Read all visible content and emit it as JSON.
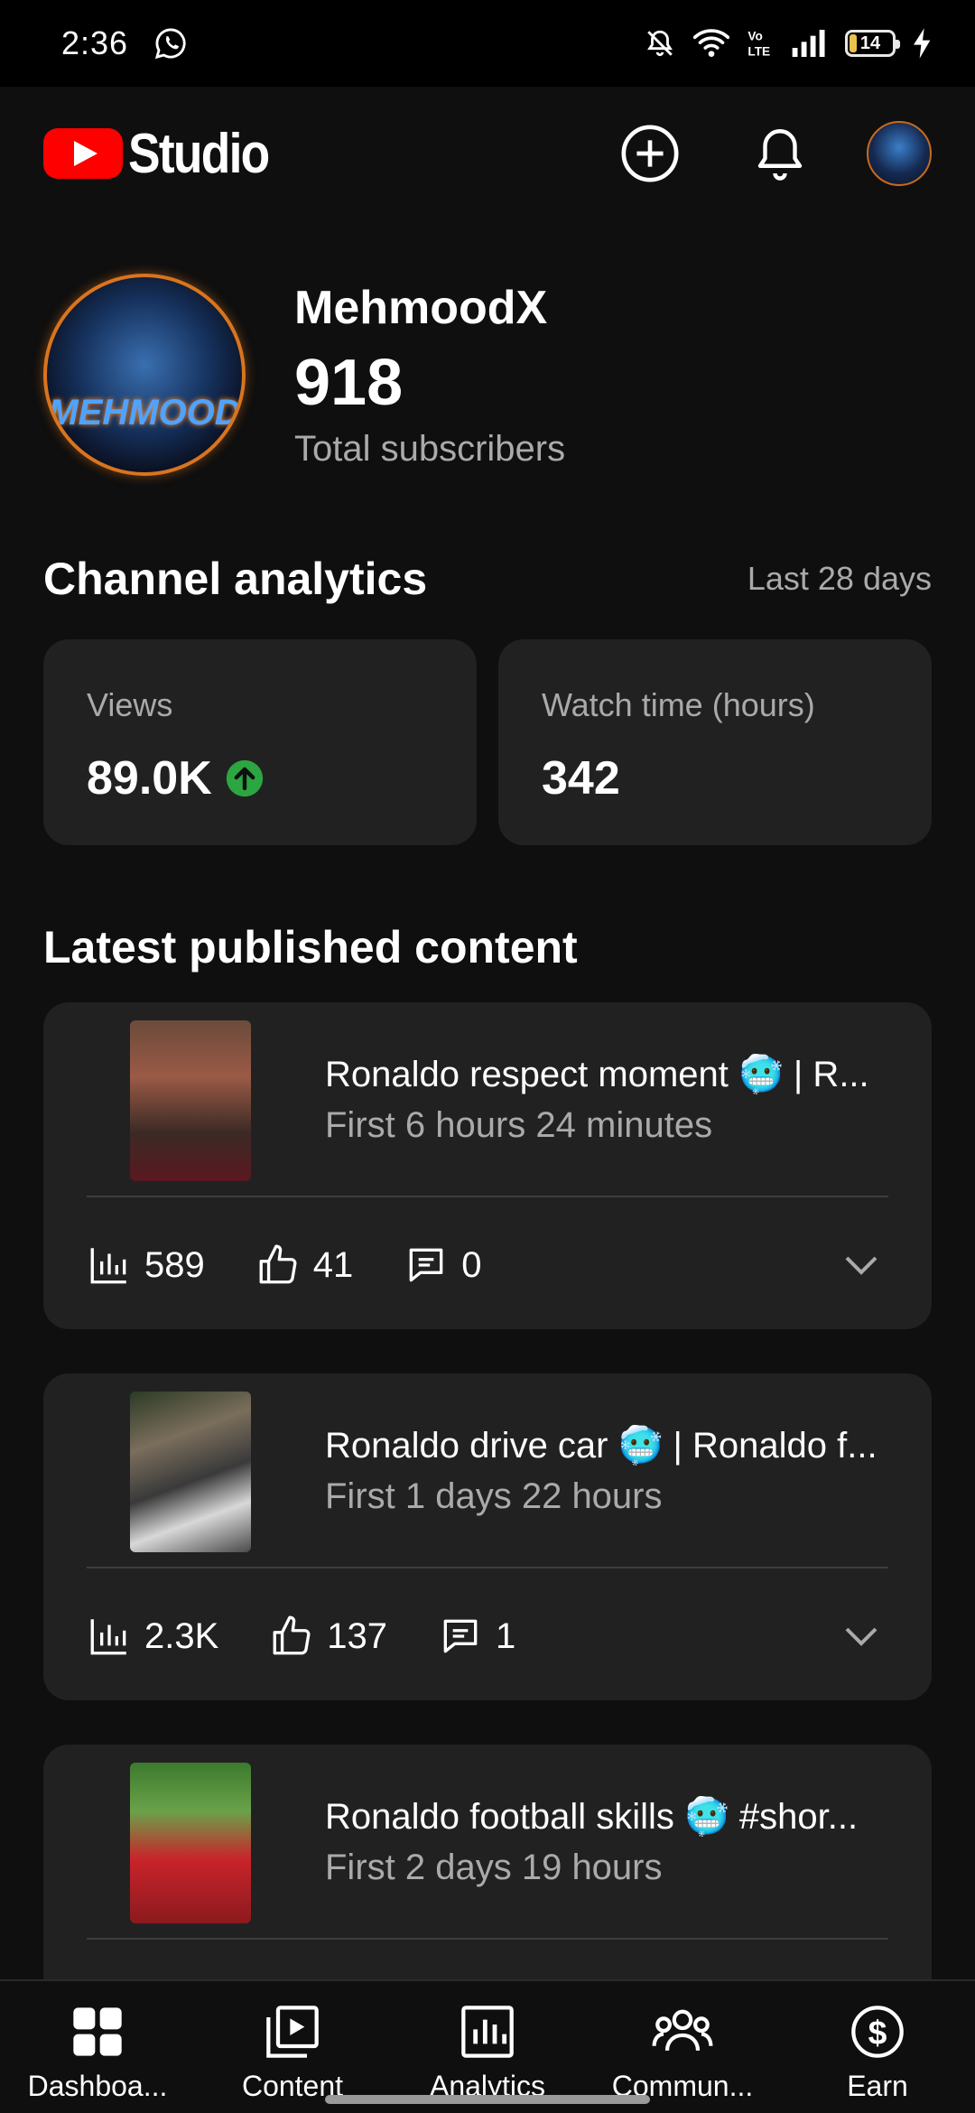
{
  "status_bar": {
    "time": "2:36",
    "battery": "14"
  },
  "header": {
    "app_name": "Studio",
    "brand_color": "#ff0000"
  },
  "channel": {
    "name": "MehmoodX",
    "subscribers": "918",
    "subscribers_label": "Total subscribers",
    "avatar_text": "MEHMOOD"
  },
  "analytics": {
    "title": "Channel analytics",
    "period": "Last 28 days",
    "views": {
      "label": "Views",
      "value": "89.0K",
      "trend": "up"
    },
    "watch_time": {
      "label": "Watch time (hours)",
      "value": "342"
    }
  },
  "latest": {
    "title": "Latest published content",
    "items": [
      {
        "title": "Ronaldo respect moment 🥶 | R...",
        "subtitle": "First 6 hours 24 minutes",
        "views": "589",
        "likes": "41",
        "comments": "0"
      },
      {
        "title": "Ronaldo drive car 🥶 | Ronaldo f...",
        "subtitle": "First 1 days 22 hours",
        "views": "2.3K",
        "likes": "137",
        "comments": "1"
      },
      {
        "title": "Ronaldo football skills 🥶 #shor...",
        "subtitle": "First 2 days 19 hours"
      }
    ]
  },
  "nav": {
    "items": [
      {
        "label": "Dashboa...",
        "icon": "dashboard-icon"
      },
      {
        "label": "Content",
        "icon": "content-icon"
      },
      {
        "label": "Analytics",
        "icon": "analytics-icon"
      },
      {
        "label": "Commun...",
        "icon": "community-icon"
      },
      {
        "label": "Earn",
        "icon": "earn-icon"
      }
    ]
  },
  "colors": {
    "background": "#0f0f0f",
    "card": "#212121",
    "secondary_text": "#aaaaaa",
    "trend_up": "#2ba640"
  }
}
